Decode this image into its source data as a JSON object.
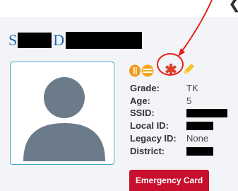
{
  "student": {
    "name_initial": "S",
    "name_mid": "D"
  },
  "details": {
    "grade_label": "Grade:",
    "grade_value": "TK",
    "age_label": "Age:",
    "age_value": "5",
    "ssid_label": "SSID:",
    "local_id_label": "Local ID:",
    "legacy_id_label": "Legacy ID:",
    "legacy_id_value": "None",
    "district_label": "District:"
  },
  "indicators": [
    {
      "icon": "meal-icon",
      "color": "#f29a1a"
    },
    {
      "icon": "transport-icon",
      "color": "#f2a61a"
    },
    {
      "icon": "medical-alert-icon",
      "color": "#d9402b"
    },
    {
      "icon": "pencil-icon",
      "color": "#f3c224"
    }
  ],
  "actions": {
    "emergency_card_label": "Emergency Card"
  },
  "colors": {
    "name": "#1f66b7",
    "annotation": "#e8201c",
    "button": "#c8102e",
    "avatar_border": "#48a6c8"
  }
}
